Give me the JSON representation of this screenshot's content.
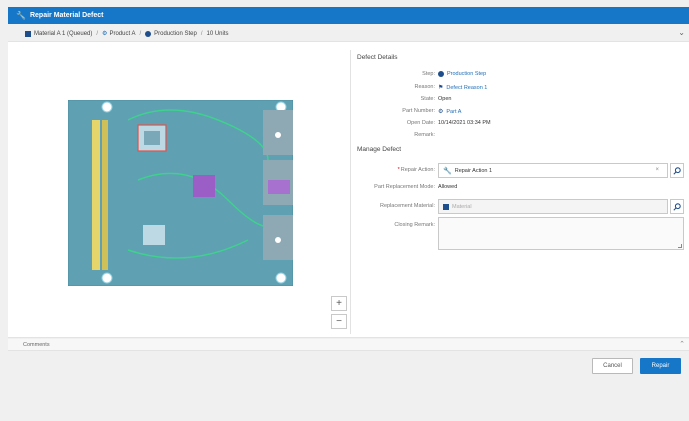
{
  "title": "Repair Material Defect",
  "breadcrumb": [
    {
      "icon": "material-icon",
      "label": "Material A 1 (Queued)"
    },
    {
      "icon": "product-icon",
      "label": "Product A"
    },
    {
      "icon": "step-icon",
      "label": "Production Step"
    },
    {
      "icon": "",
      "label": "10 Units"
    }
  ],
  "zoom": {
    "in": "+",
    "out": "−"
  },
  "defect_details": {
    "heading": "Defect Details",
    "step": {
      "label": "Step:",
      "value": "Production Step"
    },
    "reason": {
      "label": "Reason:",
      "value": "Defect Reason 1"
    },
    "state": {
      "label": "State:",
      "value": "Open"
    },
    "part_number": {
      "label": "Part Number:",
      "value": "Part A"
    },
    "open_date": {
      "label": "Open Date:",
      "value": "10/14/2021 03:34 PM"
    },
    "remark": {
      "label": "Remark:",
      "value": ""
    }
  },
  "manage_defect": {
    "heading": "Manage Defect",
    "repair_action": {
      "label": "Repair Action:",
      "value": "Repair Action 1"
    },
    "part_replacement_mode": {
      "label": "Part Replacement Mode:",
      "value": "Allowed"
    },
    "replacement_material": {
      "label": "Replacement Material:",
      "placeholder": "Material"
    },
    "closing_remark": {
      "label": "Closing Remark:",
      "value": ""
    }
  },
  "comments": {
    "label": "Comments"
  },
  "buttons": {
    "cancel": "Cancel",
    "repair": "Repair"
  },
  "colors": {
    "header": "#1677c8",
    "primary_button": "#1677c8",
    "pcb": "#5fa0b3",
    "accent_link": "#1f6fb8"
  }
}
